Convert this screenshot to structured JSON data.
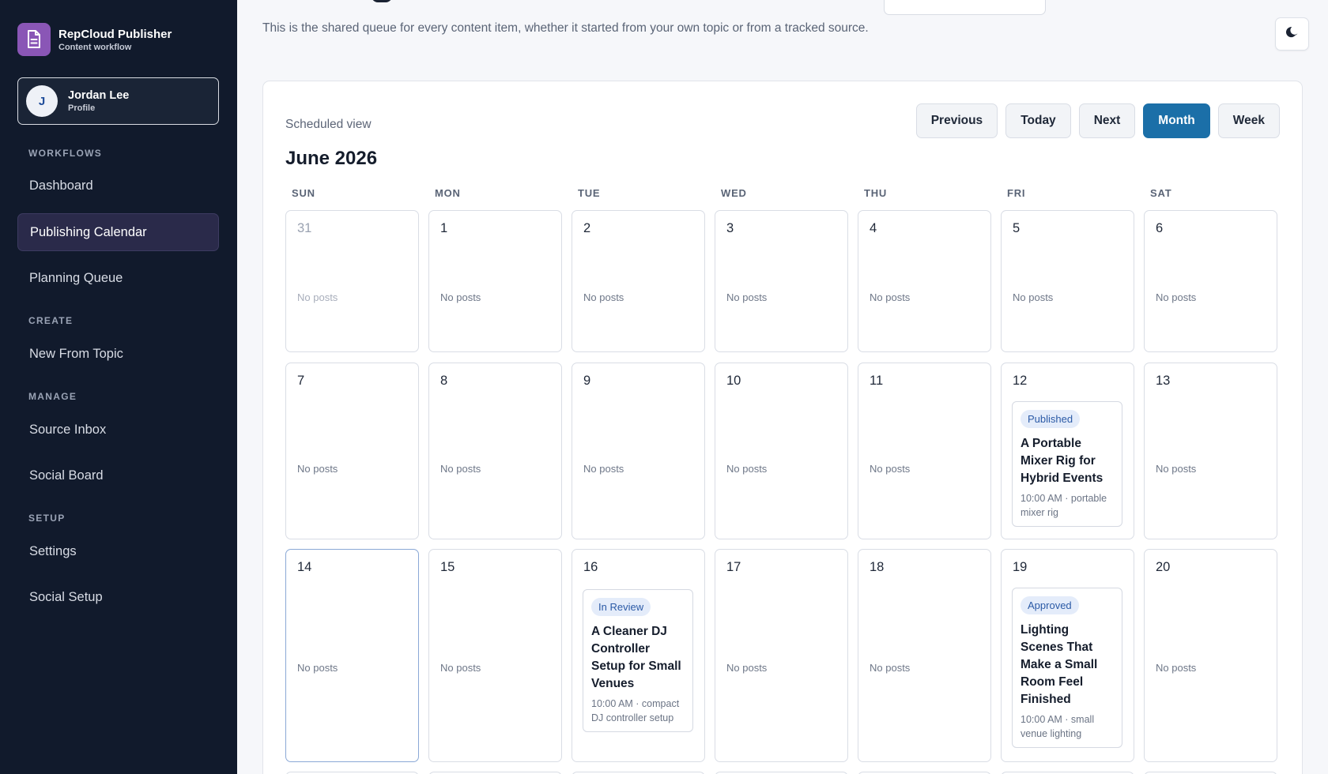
{
  "brand": {
    "title": "RepCloud Publisher",
    "subtitle": "Content workflow",
    "logo_icon": "document-icon",
    "logo_color": "#8a56b6"
  },
  "profile": {
    "initial": "J",
    "name": "Jordan Lee",
    "sub": "Profile"
  },
  "nav": {
    "sections": [
      {
        "label": "WORKFLOWS"
      },
      {
        "label": "CREATE"
      },
      {
        "label": "MANAGE"
      },
      {
        "label": "SETUP"
      }
    ],
    "items": [
      {
        "label": "Dashboard"
      },
      {
        "label": "Publishing Calendar",
        "active": true
      },
      {
        "label": "Planning Queue"
      },
      {
        "label": "New From Topic"
      },
      {
        "label": "Source Inbox"
      },
      {
        "label": "Social Board"
      },
      {
        "label": "Settings"
      },
      {
        "label": "Social Setup"
      }
    ]
  },
  "header": {
    "description": "This is the shared queue for every content item, whether it started from your own topic or from a tracked source.",
    "theme_icon": "moon-icon"
  },
  "calendar": {
    "view_label": "Scheduled view",
    "month_title": "June 2026",
    "buttons": {
      "previous": "Previous",
      "today": "Today",
      "next": "Next",
      "month": "Month",
      "week": "Week"
    },
    "active_view": "Month",
    "accent": "#1b6fa8",
    "weekdays": [
      "SUN",
      "MON",
      "TUE",
      "WED",
      "THU",
      "FRI",
      "SAT"
    ],
    "empty_text": "No posts",
    "weeks": [
      [
        "31",
        "1",
        "2",
        "3",
        "4",
        "5",
        "6"
      ],
      [
        "7",
        "8",
        "9",
        "10",
        "11",
        "12",
        "13"
      ],
      [
        "14",
        "15",
        "16",
        "17",
        "18",
        "19",
        "20"
      ]
    ],
    "posts": {
      "12": {
        "status": "Published",
        "title": "A Portable Mixer Rig for Hybrid Events",
        "meta": "10:00 AM · portable mixer rig"
      },
      "16": {
        "status": "In Review",
        "title": "A Cleaner DJ Controller Setup for Small Venues",
        "meta": "10:00 AM · compact DJ controller setup"
      },
      "19": {
        "status": "Approved",
        "title": "Lighting Scenes That Make a Small Room Feel Finished",
        "meta": "10:00 AM · small venue lighting"
      }
    }
  }
}
